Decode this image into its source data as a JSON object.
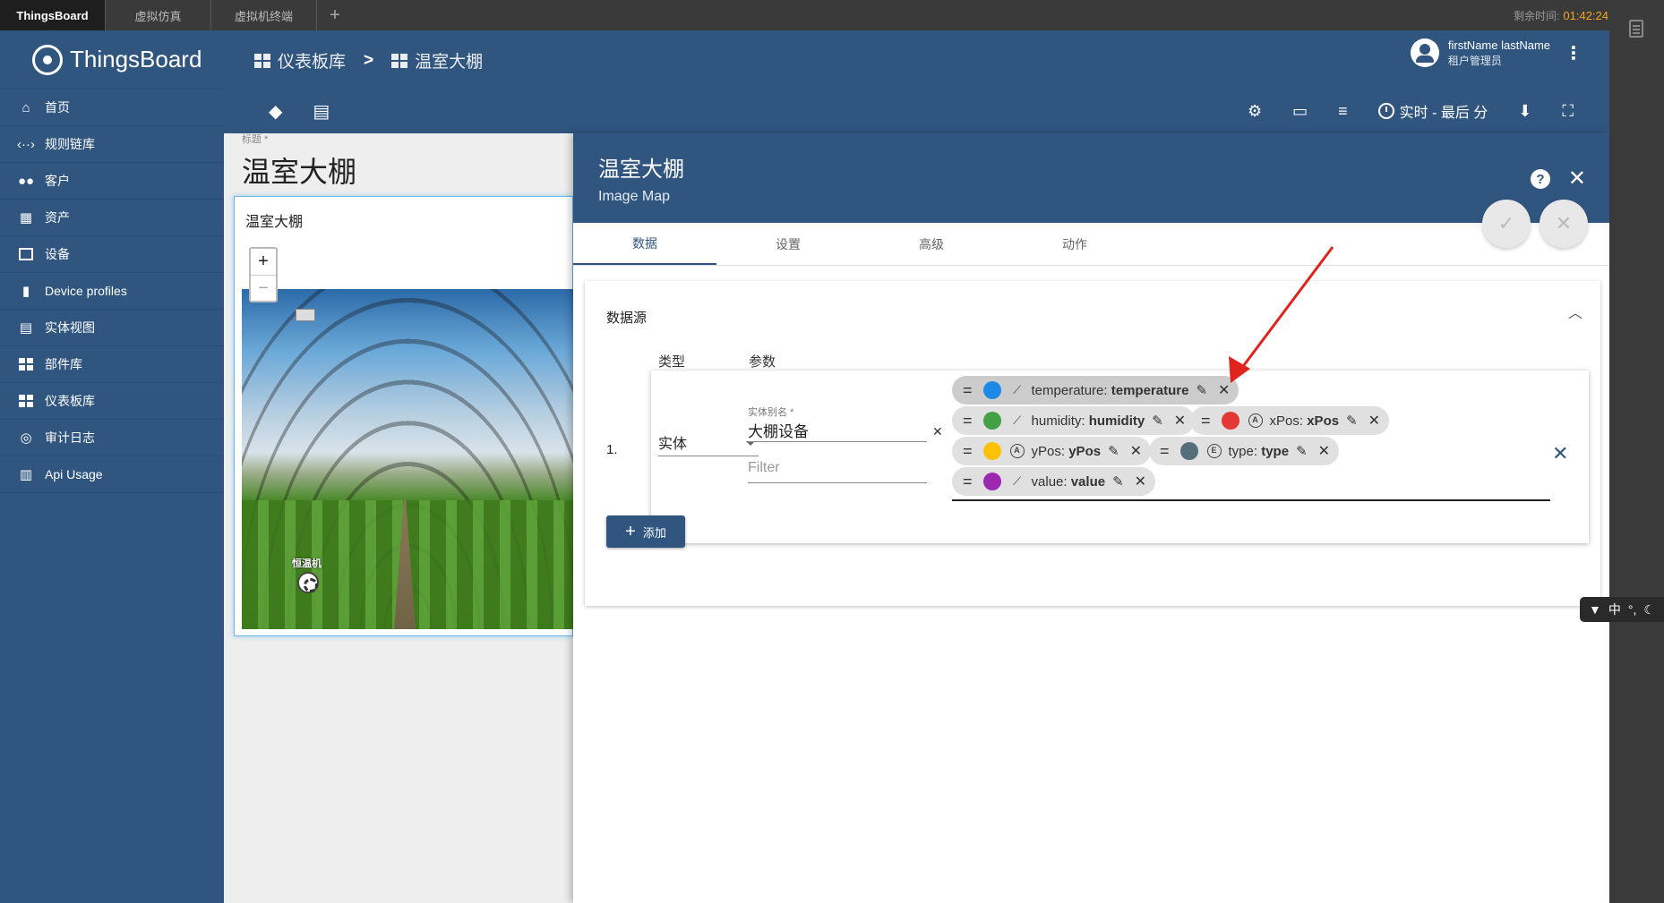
{
  "top_tabs": [
    {
      "label": "ThingsBoard",
      "active": true
    },
    {
      "label": "虚拟仿真",
      "active": false
    },
    {
      "label": "虚拟机终端",
      "active": false
    }
  ],
  "top_add_label": "+",
  "timer": {
    "label": "剩余时间:",
    "value": "01:42:24"
  },
  "sidebar": {
    "brand": "ThingsBoard",
    "items": [
      {
        "label": "首页",
        "icon": "home-icon"
      },
      {
        "label": "规则链库",
        "icon": "rule-chain-icon"
      },
      {
        "label": "客户",
        "icon": "people-icon"
      },
      {
        "label": "资产",
        "icon": "building-icon"
      },
      {
        "label": "设备",
        "icon": "devices-icon"
      },
      {
        "label": "Device profiles",
        "icon": "device-profile-icon"
      },
      {
        "label": "实体视图",
        "icon": "entity-view-icon"
      },
      {
        "label": "部件库",
        "icon": "widgets-icon"
      },
      {
        "label": "仪表板库",
        "icon": "dashboards-icon"
      },
      {
        "label": "审计日志",
        "icon": "audit-icon"
      },
      {
        "label": "Api Usage",
        "icon": "chart-icon"
      }
    ]
  },
  "header": {
    "breadcrumb": [
      "仪表板库",
      "温室大棚"
    ],
    "separator": ">",
    "user_name": "firstName lastName",
    "user_role": "租户管理员",
    "timewindow_label": "实时 - 最后 分"
  },
  "dashboard": {
    "title_label": "标题 *",
    "title": "温室大棚",
    "widget_title": "温室大棚",
    "zoom_in": "+",
    "zoom_out": "−",
    "marker_label": "恒温机"
  },
  "panel": {
    "title": "温室大棚",
    "subtitle": "Image Map",
    "help": "?",
    "tabs": [
      {
        "label": "数据",
        "active": true
      },
      {
        "label": "设置",
        "active": false
      },
      {
        "label": "高级",
        "active": false
      },
      {
        "label": "动作",
        "active": false
      }
    ],
    "datasource": {
      "section_title": "数据源",
      "col_type": "类型",
      "col_params": "参数",
      "row_number": "1.",
      "type_value": "实体",
      "alias_label": "实体别名 *",
      "alias_value": "大棚设备",
      "filter_placeholder": "Filter",
      "chips": [
        {
          "key": "temperature",
          "label": "temperature",
          "color": "#1e88e5",
          "kind": "timeseries"
        },
        {
          "key": "humidity",
          "label": "humidity",
          "color": "#43a047",
          "kind": "timeseries"
        },
        {
          "key": "xPos",
          "label": "xPos",
          "color": "#e53935",
          "kind": "attribute"
        },
        {
          "key": "yPos",
          "label": "yPos",
          "color": "#ffc107",
          "kind": "attribute"
        },
        {
          "key": "type",
          "label": "type",
          "color": "#546e7a",
          "kind": "entity-field"
        },
        {
          "key": "value",
          "label": "value",
          "color": "#9c27b0",
          "kind": "timeseries"
        }
      ]
    },
    "add_label": "添加"
  },
  "ime": {
    "label": "中"
  },
  "colors": {
    "primary": "#305680",
    "accent_timer": "#f6a623",
    "arrow": "#e0231c"
  }
}
